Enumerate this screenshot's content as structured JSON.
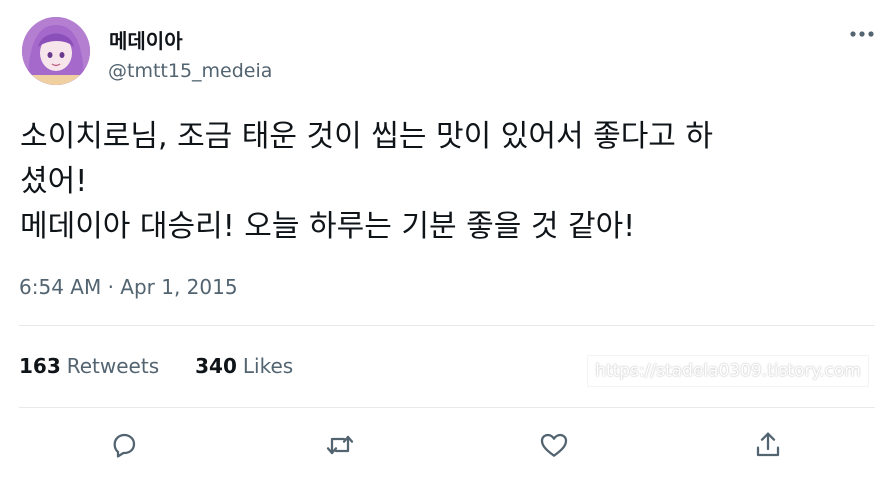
{
  "author": {
    "display_name": "메데이아",
    "handle": "@tmtt15_medeia"
  },
  "tweet": {
    "text": "소이치로님, 조금 태운 것이 씹는 맛이 있어서 좋다고 하\n셨어!\n메데이아 대승리! 오늘 하루는 기분 좋을 것 같아!",
    "timestamp": "6:54 AM · Apr 1, 2015"
  },
  "stats": {
    "retweets_count": "163",
    "retweets_label": "Retweets",
    "likes_count": "340",
    "likes_label": "Likes"
  },
  "watermark": "https://stadela0309.tistory.com",
  "icons": {
    "more": "more-icon",
    "reply": "reply-icon",
    "retweet": "retweet-icon",
    "like": "like-icon",
    "share": "share-icon"
  },
  "colors": {
    "text": "#0f1419",
    "secondary": "#536471",
    "icon": "#536471"
  }
}
